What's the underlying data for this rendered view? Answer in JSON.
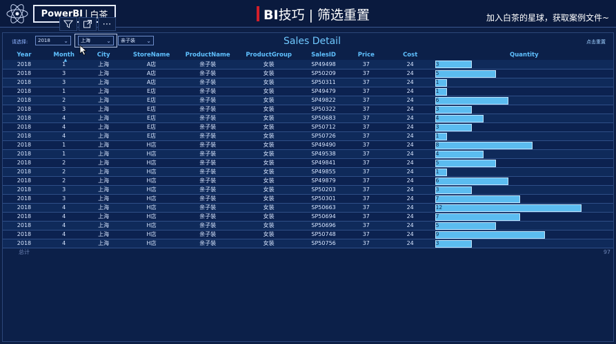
{
  "header": {
    "brand_main": "PowerBI",
    "brand_sep": "|",
    "brand_sub": "白茶",
    "title_prefix": "BI",
    "title_rest": "技巧 | 筛选重置",
    "promo": "加入白茶的星球，获取案例文件~"
  },
  "filters": {
    "label": "请选择:",
    "year": "2018",
    "city": "上海",
    "product": "亲子装"
  },
  "visual_tools": {
    "filter_icon": "filter-icon",
    "focus_icon": "focus-mode-icon",
    "more_icon": "more-options-icon"
  },
  "report": {
    "title": "Sales Detail",
    "reset_label": "点击重置"
  },
  "table": {
    "columns": [
      "Year",
      "Month",
      "City",
      "StoreName",
      "ProductName",
      "ProductGroup",
      "SalesID",
      "Price",
      "Cost",
      "Quantity"
    ],
    "rows": [
      [
        "2018",
        "1",
        "上海",
        "A店",
        "亲子装",
        "女装",
        "SP49498",
        "37",
        "24",
        "3"
      ],
      [
        "2018",
        "3",
        "上海",
        "A店",
        "亲子装",
        "女装",
        "SP50209",
        "37",
        "24",
        "5"
      ],
      [
        "2018",
        "3",
        "上海",
        "A店",
        "亲子装",
        "女装",
        "SP50311",
        "37",
        "24",
        "1"
      ],
      [
        "2018",
        "1",
        "上海",
        "E店",
        "亲子装",
        "女装",
        "SP49479",
        "37",
        "24",
        "1"
      ],
      [
        "2018",
        "2",
        "上海",
        "E店",
        "亲子装",
        "女装",
        "SP49822",
        "37",
        "24",
        "6"
      ],
      [
        "2018",
        "3",
        "上海",
        "E店",
        "亲子装",
        "女装",
        "SP50322",
        "37",
        "24",
        "3"
      ],
      [
        "2018",
        "4",
        "上海",
        "E店",
        "亲子装",
        "女装",
        "SP50683",
        "37",
        "24",
        "4"
      ],
      [
        "2018",
        "4",
        "上海",
        "E店",
        "亲子装",
        "女装",
        "SP50712",
        "37",
        "24",
        "3"
      ],
      [
        "2018",
        "4",
        "上海",
        "E店",
        "亲子装",
        "女装",
        "SP50726",
        "37",
        "24",
        "1"
      ],
      [
        "2018",
        "1",
        "上海",
        "H店",
        "亲子装",
        "女装",
        "SP49490",
        "37",
        "24",
        "8"
      ],
      [
        "2018",
        "1",
        "上海",
        "H店",
        "亲子装",
        "女装",
        "SP49538",
        "37",
        "24",
        "4"
      ],
      [
        "2018",
        "2",
        "上海",
        "H店",
        "亲子装",
        "女装",
        "SP49841",
        "37",
        "24",
        "5"
      ],
      [
        "2018",
        "2",
        "上海",
        "H店",
        "亲子装",
        "女装",
        "SP49855",
        "37",
        "24",
        "1"
      ],
      [
        "2018",
        "2",
        "上海",
        "H店",
        "亲子装",
        "女装",
        "SP49879",
        "37",
        "24",
        "6"
      ],
      [
        "2018",
        "3",
        "上海",
        "H店",
        "亲子装",
        "女装",
        "SP50203",
        "37",
        "24",
        "3"
      ],
      [
        "2018",
        "3",
        "上海",
        "H店",
        "亲子装",
        "女装",
        "SP50301",
        "37",
        "24",
        "7"
      ],
      [
        "2018",
        "4",
        "上海",
        "H店",
        "亲子装",
        "女装",
        "SP50663",
        "37",
        "24",
        "12"
      ],
      [
        "2018",
        "4",
        "上海",
        "H店",
        "亲子装",
        "女装",
        "SP50694",
        "37",
        "24",
        "7"
      ],
      [
        "2018",
        "4",
        "上海",
        "H店",
        "亲子装",
        "女装",
        "SP50696",
        "37",
        "24",
        "5"
      ],
      [
        "2018",
        "4",
        "上海",
        "H店",
        "亲子装",
        "女装",
        "SP50748",
        "37",
        "24",
        "9"
      ],
      [
        "2018",
        "4",
        "上海",
        "H店",
        "亲子装",
        "女装",
        "SP50756",
        "37",
        "24",
        "3"
      ]
    ],
    "quantity_max": 12,
    "totals_label": "总计",
    "totals_quantity": "97"
  },
  "colors": {
    "background": "#0d1f45",
    "header_text": "#5fc0ff",
    "bar": "#5bbcf0",
    "accent_red": "#d21f2a"
  }
}
